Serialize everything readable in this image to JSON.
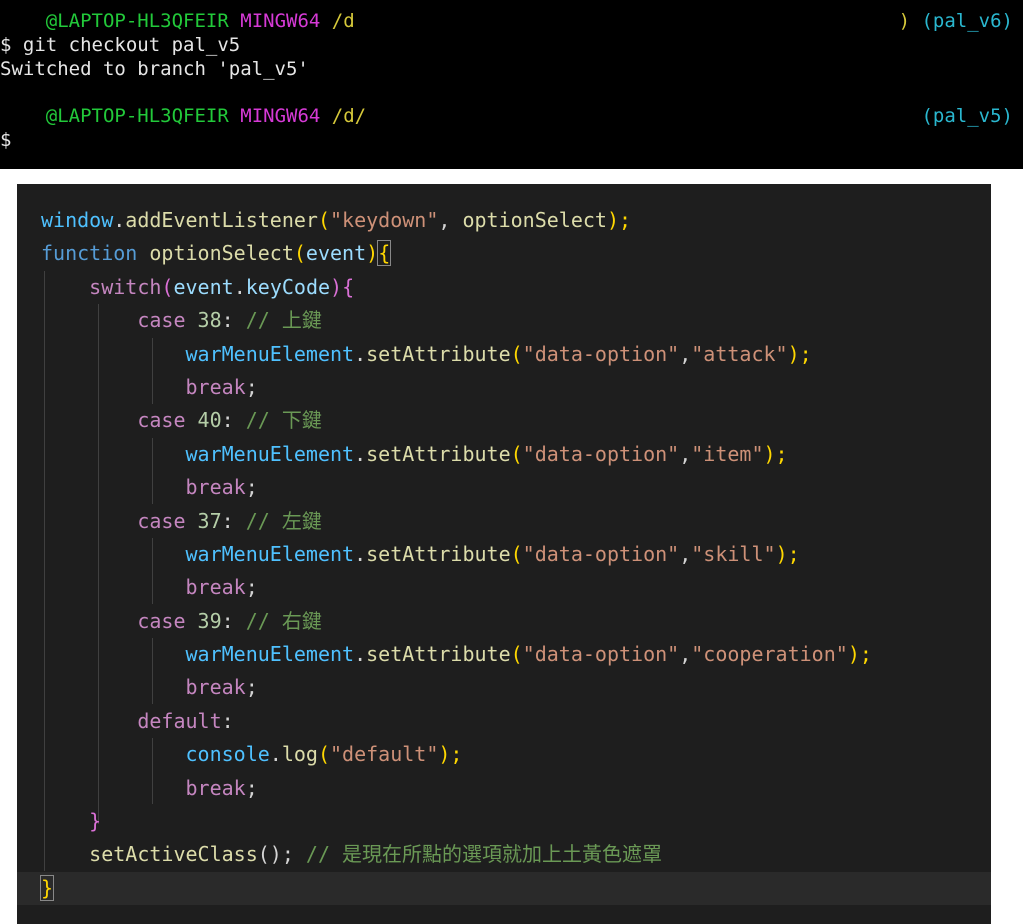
{
  "terminal": {
    "prompt1": {
      "user_host": "@LAPTOP-HL3QFEIR",
      "env": "MINGW64",
      "path": "/d",
      "branch_prefix": ")",
      "branch": "(pal_v6)"
    },
    "cmd": "$ git checkout pal_v5",
    "output": "Switched to branch 'pal_v5'",
    "prompt2": {
      "user_host": "@LAPTOP-HL3QFEIR",
      "env": "MINGW64",
      "path": "/d/",
      "branch": "(pal_v5)"
    },
    "input_prompt": "$"
  },
  "editor": {
    "lines": {
      "l1": {
        "obj": "window",
        "dot": ".",
        "fn": "addEventListener",
        "open": "(",
        "str": "\"keydown\"",
        "comma": ", ",
        "arg": "optionSelect",
        "close": ");"
      },
      "l2": {
        "kw": "function",
        "sp": " ",
        "fn": "optionSelect",
        "open": "(",
        "param": "event",
        "close": ")",
        "brace": "{"
      },
      "l3": {
        "kw": "switch",
        "open": "(",
        "obj": "event",
        "dot": ".",
        "prop": "keyCode",
        "close": ")",
        "brace": "{"
      },
      "case38": {
        "kw": "case",
        "num": "38",
        "colon": ":",
        "cmt": "// 上鍵"
      },
      "set1": {
        "obj": "warMenuElement",
        "dot": ".",
        "fn": "setAttribute",
        "open": "(",
        "s1": "\"data-option\"",
        "comma": ",",
        "s2": "\"attack\"",
        "close": ");"
      },
      "break1": "break",
      "case40": {
        "kw": "case",
        "num": "40",
        "colon": ":",
        "cmt": "// 下鍵"
      },
      "set2": {
        "s2": "\"item\""
      },
      "case37": {
        "kw": "case",
        "num": "37",
        "colon": ":",
        "cmt": "// 左鍵"
      },
      "set3": {
        "s2": "\"skill\""
      },
      "case39": {
        "kw": "case",
        "num": "39",
        "colon": ":",
        "cmt": "// 右鍵"
      },
      "set4": {
        "s2": "\"cooperation\""
      },
      "default": {
        "kw": "default",
        "colon": ":"
      },
      "log": {
        "obj": "console",
        "dot": ".",
        "fn": "log",
        "open": "(",
        "str": "\"default\"",
        "close": ");"
      },
      "semi": ";",
      "close_switch": "}",
      "active": {
        "fn": "setActiveClass",
        "call": "();",
        "cmt": "// 是現在所點的選項就加上土黃色遮罩"
      },
      "close_fn": "}"
    }
  }
}
